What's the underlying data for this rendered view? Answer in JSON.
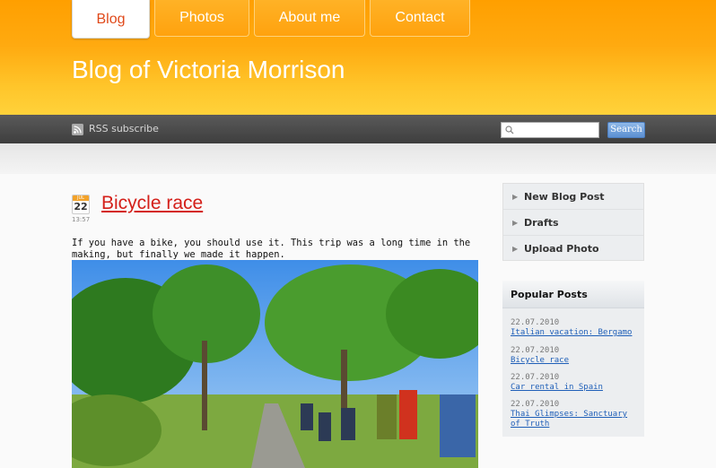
{
  "nav": {
    "tabs": [
      {
        "label": "Blog",
        "active": true
      },
      {
        "label": "Photos",
        "active": false
      },
      {
        "label": "About me",
        "active": false
      },
      {
        "label": "Contact",
        "active": false
      }
    ]
  },
  "site": {
    "title": "Blog of Victoria Morrison"
  },
  "toolbar": {
    "rss_label": "RSS subscribe",
    "search_placeholder": "",
    "search_button": "Search"
  },
  "post": {
    "month": "JUL",
    "day": "22",
    "time": "13:57",
    "title": "Bicycle race",
    "text": "If you have a bike, you should use it. This trip was a long time in the making, but finally we made it happen."
  },
  "sidebar": {
    "menu": [
      "New Blog Post",
      "Drafts",
      "Upload Photo"
    ],
    "popular_title": "Popular Posts",
    "popular": [
      {
        "date": "22.07.2010",
        "title": "Italian vacation: Bergamo"
      },
      {
        "date": "22.07.2010",
        "title": "Bicycle race"
      },
      {
        "date": "22.07.2010",
        "title": "Car rental in Spain"
      },
      {
        "date": "22.07.2010",
        "title": "Thai Glimpses: Sanctuary of Truth"
      }
    ]
  },
  "colors": {
    "header": "#ffa500",
    "post_title": "#d4201a",
    "link": "#1f5fb8",
    "search_button": "#5c90d2"
  },
  "icons": {
    "rss": "rss-icon",
    "search": "search-icon",
    "menu_arrow": "arrow-right-icon"
  }
}
